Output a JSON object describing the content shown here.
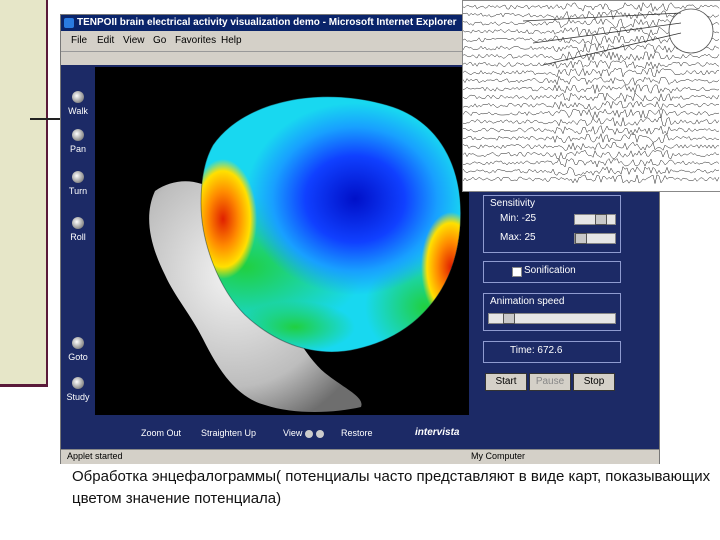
{
  "window": {
    "title": "TENPOII brain electrical activity visualization demo - Microsoft Internet Explorer"
  },
  "menu": [
    "File",
    "Edit",
    "View",
    "Go",
    "Favorites",
    "Help"
  ],
  "nav_buttons": [
    {
      "label": "Walk",
      "icon": "walk-icon"
    },
    {
      "label": "Pan",
      "icon": "pan-icon"
    },
    {
      "label": "Turn",
      "icon": "turn-icon"
    },
    {
      "label": "Roll",
      "icon": "roll-icon"
    },
    {
      "label": "Goto",
      "icon": "goto-icon"
    },
    {
      "label": "Study",
      "icon": "study-icon"
    }
  ],
  "bottom_bar": {
    "zoom_out": "Zoom Out",
    "straighten_up": "Straighten Up",
    "view": "View",
    "restore": "Restore",
    "brand": "intervista"
  },
  "panel": {
    "sensitivity": {
      "title": "Sensitivity",
      "min_label": "Min: -25",
      "max_label": "Max: 25",
      "min_value": -25,
      "max_value": 25
    },
    "sonification_label": "Sonification",
    "animation_speed_label": "Animation speed",
    "time_label": "Time: 672.6",
    "buttons": {
      "start": "Start",
      "pause": "Pause",
      "stop": "Stop"
    }
  },
  "status": {
    "left": "Applet started",
    "right": "My Computer"
  },
  "caption": "Обработка энцефалограммы( потенциалы часто представляют в виде карт, показывающих цветом значение потенциала)",
  "colors": {
    "applet_bg": "#1c2a66",
    "titlebar": "#0a246a",
    "slide_strip": "#e6e6c8",
    "slide_accent": "#5a1a3a"
  }
}
